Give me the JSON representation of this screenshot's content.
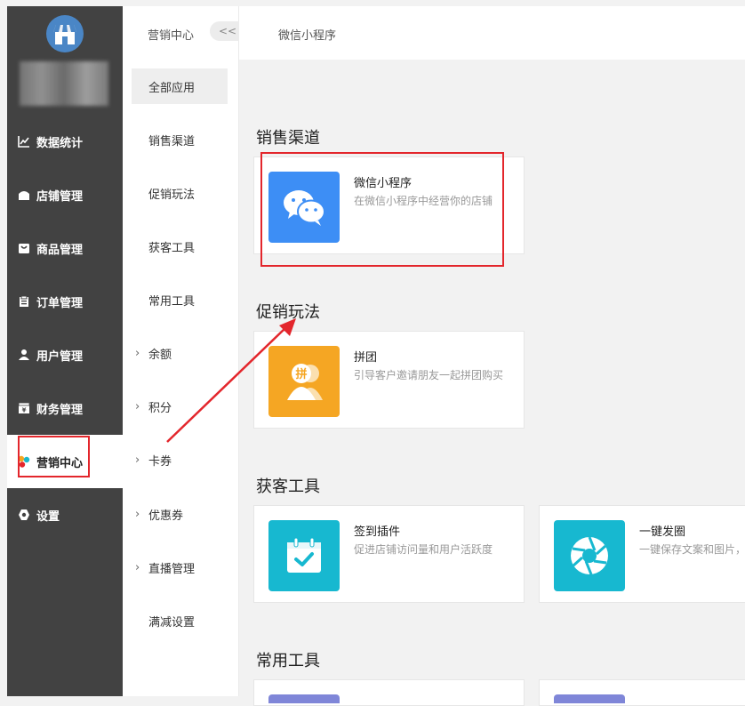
{
  "sidebar": {
    "items": [
      {
        "label": "数据统计",
        "icon": "line-chart-icon"
      },
      {
        "label": "店铺管理",
        "icon": "shop-icon"
      },
      {
        "label": "商品管理",
        "icon": "goods-icon"
      },
      {
        "label": "订单管理",
        "icon": "order-icon"
      },
      {
        "label": "用户管理",
        "icon": "user-icon"
      },
      {
        "label": "财务管理",
        "icon": "finance-icon"
      },
      {
        "label": "营销中心",
        "icon": "marketing-icon"
      },
      {
        "label": "设置",
        "icon": "settings-icon"
      }
    ],
    "active_index": 6
  },
  "submenu": {
    "title": "营销中心",
    "collapse_label": "<<",
    "items": [
      {
        "label": "全部应用",
        "selected": true,
        "expandable": false
      },
      {
        "label": "销售渠道",
        "selected": false,
        "expandable": false
      },
      {
        "label": "促销玩法",
        "selected": false,
        "expandable": false
      },
      {
        "label": "获客工具",
        "selected": false,
        "expandable": false
      },
      {
        "label": "常用工具",
        "selected": false,
        "expandable": false
      },
      {
        "label": "余额",
        "selected": false,
        "expandable": true
      },
      {
        "label": "积分",
        "selected": false,
        "expandable": true
      },
      {
        "label": "卡券",
        "selected": false,
        "expandable": true
      },
      {
        "label": "优惠券",
        "selected": false,
        "expandable": true
      },
      {
        "label": "直播管理",
        "selected": false,
        "expandable": true
      },
      {
        "label": "满减设置",
        "selected": false,
        "expandable": false
      }
    ]
  },
  "header": {
    "breadcrumb": "微信小程序"
  },
  "sections": {
    "sales": {
      "title": "销售渠道"
    },
    "promo": {
      "title": "促销玩法"
    },
    "acquire": {
      "title": "获客工具"
    },
    "tools": {
      "title": "常用工具"
    }
  },
  "cards": {
    "wechat": {
      "title": "微信小程序",
      "desc": "在微信小程序中经营你的店铺",
      "color": "#3d8ef5"
    },
    "group": {
      "title": "拼团",
      "desc": "引导客户邀请朋友一起拼团购买",
      "color": "#f5a623"
    },
    "checkin": {
      "title": "签到插件",
      "desc": "促进店铺访问量和用户活跃度",
      "color": "#17b8d0"
    },
    "moments": {
      "title": "一键发圈",
      "desc": "一键保存文案和图片，",
      "color": "#17b8d0"
    }
  }
}
